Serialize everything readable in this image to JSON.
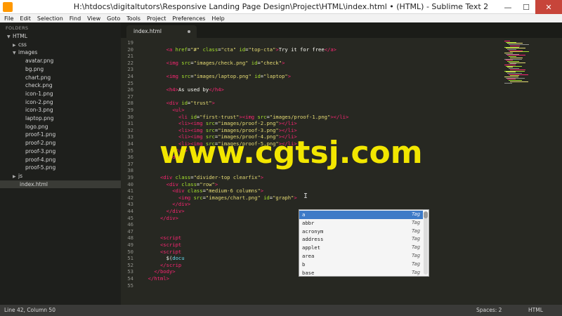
{
  "window": {
    "title": "H:\\htdocs\\digitaltutors\\Responsive Landing Page Design\\Project\\HTML\\index.html • (HTML) - Sublime Text 2",
    "minimize": "—",
    "maximize": "☐",
    "close": "✕"
  },
  "menu": [
    "File",
    "Edit",
    "Selection",
    "Find",
    "View",
    "Goto",
    "Tools",
    "Project",
    "Preferences",
    "Help"
  ],
  "sidebar": {
    "folders_label": "FOLDERS",
    "items": [
      {
        "label": "HTML",
        "arrow": "▼",
        "level": 0
      },
      {
        "label": "css",
        "arrow": "▶",
        "level": 1
      },
      {
        "label": "images",
        "arrow": "▼",
        "level": 1
      },
      {
        "label": "avatar.png",
        "arrow": "",
        "level": 2
      },
      {
        "label": "bg.png",
        "arrow": "",
        "level": 2
      },
      {
        "label": "chart.png",
        "arrow": "",
        "level": 2
      },
      {
        "label": "check.png",
        "arrow": "",
        "level": 2
      },
      {
        "label": "icon-1.png",
        "arrow": "",
        "level": 2
      },
      {
        "label": "icon-2.png",
        "arrow": "",
        "level": 2
      },
      {
        "label": "icon-3.png",
        "arrow": "",
        "level": 2
      },
      {
        "label": "laptop.png",
        "arrow": "",
        "level": 2
      },
      {
        "label": "logo.png",
        "arrow": "",
        "level": 2
      },
      {
        "label": "proof-1.png",
        "arrow": "",
        "level": 2
      },
      {
        "label": "proof-2.png",
        "arrow": "",
        "level": 2
      },
      {
        "label": "proof-3.png",
        "arrow": "",
        "level": 2
      },
      {
        "label": "proof-4.png",
        "arrow": "",
        "level": 2
      },
      {
        "label": "proof-5.png",
        "arrow": "",
        "level": 2
      },
      {
        "label": "js",
        "arrow": "▶",
        "level": 1
      },
      {
        "label": "index.html",
        "arrow": "",
        "level": 1,
        "selected": true
      }
    ]
  },
  "tab": {
    "label": "index.html"
  },
  "editor": {
    "lines": [
      {
        "n": "19",
        "html": ""
      },
      {
        "n": "20",
        "html": "        <span class='t'>&lt;a</span> <span class='a'>href</span>=<span class='s'>\"#\"</span> <span class='a'>class</span>=<span class='s'>\"cta\"</span> <span class='a'>id</span>=<span class='s'>\"top-cta\"</span><span class='t'>&gt;</span>Try it for free<span class='t'>&lt;/a&gt;</span>"
      },
      {
        "n": "21",
        "html": ""
      },
      {
        "n": "22",
        "html": "        <span class='t'>&lt;img</span> <span class='a'>src</span>=<span class='s'>\"images/check.png\"</span> <span class='a'>id</span>=<span class='s'>\"check\"</span><span class='t'>&gt;</span>"
      },
      {
        "n": "23",
        "html": ""
      },
      {
        "n": "24",
        "html": "        <span class='t'>&lt;img</span> <span class='a'>src</span>=<span class='s'>\"images/laptop.png\"</span> <span class='a'>id</span>=<span class='s'>\"laptop\"</span><span class='t'>&gt;</span>"
      },
      {
        "n": "25",
        "html": ""
      },
      {
        "n": "26",
        "html": "        <span class='t'>&lt;h4&gt;</span>As used by<span class='t'>&lt;/h4&gt;</span>"
      },
      {
        "n": "27",
        "html": ""
      },
      {
        "n": "28",
        "html": "        <span class='t'>&lt;div</span> <span class='a'>id</span>=<span class='s'>\"trust\"</span><span class='t'>&gt;</span>"
      },
      {
        "n": "29",
        "html": "          <span class='t'>&lt;ul&gt;</span>"
      },
      {
        "n": "30",
        "html": "            <span class='t'>&lt;li</span> <span class='a'>id</span>=<span class='s'>\"first-trust\"</span><span class='t'>&gt;&lt;img</span> <span class='a'>src</span>=<span class='s'>\"images/proof-1.png\"</span><span class='t'>&gt;&lt;/li&gt;</span>"
      },
      {
        "n": "31",
        "html": "            <span class='t'>&lt;li&gt;&lt;img</span> <span class='a'>src</span>=<span class='s'>\"images/proof-2.png\"</span><span class='t'>&gt;&lt;/li&gt;</span>"
      },
      {
        "n": "32",
        "html": "            <span class='t'>&lt;li&gt;&lt;img</span> <span class='a'>src</span>=<span class='s'>\"images/proof-3.png\"</span><span class='t'>&gt;&lt;/li&gt;</span>"
      },
      {
        "n": "33",
        "html": "            <span class='t'>&lt;li&gt;&lt;img</span> <span class='a'>src</span>=<span class='s'>\"images/proof-4.png\"</span><span class='t'>&gt;&lt;/li&gt;</span>"
      },
      {
        "n": "34",
        "html": "            <span class='t'>&lt;li&gt;&lt;img</span> <span class='a'>src</span>=<span class='s'>\"images/proof-5.png\"</span><span class='t'>&gt;&lt;/li&gt;</span>"
      },
      {
        "n": "35",
        "html": "          <span class='t'>&lt;/ul&gt;</span>"
      },
      {
        "n": "36",
        "html": "        <span class='t'>&lt;/div&gt;</span>"
      },
      {
        "n": "37",
        "html": ""
      },
      {
        "n": "38",
        "html": ""
      },
      {
        "n": "39",
        "html": "      <span class='t'>&lt;div</span> <span class='a'>class</span>=<span class='s'>\"divider-top clearfix\"</span><span class='t'>&gt;</span>"
      },
      {
        "n": "40",
        "html": "        <span class='t'>&lt;div</span> <span class='a'>class</span>=<span class='s'>\"row\"</span><span class='t'>&gt;</span>"
      },
      {
        "n": "41",
        "html": "          <span class='t'>&lt;div</span> <span class='a'>class</span>=<span class='s'>\"medium-6 columns\"</span><span class='t'>&gt;</span>"
      },
      {
        "n": "42",
        "html": "            <span class='t'>&lt;img</span> <span class='a'>src</span>=<span class='s'>\"images/chart.png\"</span> <span class='a'>id</span>=<span class='s'>\"graph\"</span><span class='t'>&gt;</span>"
      },
      {
        "n": "43",
        "html": "          <span class='t'>&lt;/div&gt;</span>"
      },
      {
        "n": "44",
        "html": "        <span class='t'>&lt;/div&gt;</span>"
      },
      {
        "n": "45",
        "html": "      <span class='t'>&lt;/div&gt;</span>"
      },
      {
        "n": "46",
        "html": ""
      },
      {
        "n": "47",
        "html": ""
      },
      {
        "n": "48",
        "html": "      <span class='t'>&lt;script</span>"
      },
      {
        "n": "49",
        "html": "      <span class='t'>&lt;script</span>"
      },
      {
        "n": "50",
        "html": "      <span class='t'>&lt;script</span>"
      },
      {
        "n": "51",
        "html": "        <span class='p'>$(</span><span class='f'>docu</span>"
      },
      {
        "n": "52",
        "html": "      <span class='t'>&lt;/scrip</span>"
      },
      {
        "n": "53",
        "html": "    <span class='t'>&lt;/body&gt;</span>"
      },
      {
        "n": "54",
        "html": "  <span class='t'>&lt;/html&gt;</span>"
      },
      {
        "n": "55",
        "html": ""
      }
    ]
  },
  "autocomplete": {
    "items": [
      {
        "label": "a",
        "kind": "Tag",
        "active": true
      },
      {
        "label": "abbr",
        "kind": "Tag"
      },
      {
        "label": "acronym",
        "kind": "Tag"
      },
      {
        "label": "address",
        "kind": "Tag"
      },
      {
        "label": "applet",
        "kind": "Tag"
      },
      {
        "label": "area",
        "kind": "Tag"
      },
      {
        "label": "b",
        "kind": "Tag"
      },
      {
        "label": "base",
        "kind": "Tag"
      }
    ]
  },
  "watermark": "www.cgtsj.com",
  "status": {
    "position": "Line 42, Column 50",
    "spaces": "Spaces: 2",
    "syntax": "HTML"
  },
  "colors": {
    "editor_bg": "#272822",
    "tag": "#f92672",
    "attribute": "#a6e22e",
    "string": "#e6db74",
    "watermark": "#f2e600",
    "ac_highlight": "#3d7ac7"
  }
}
